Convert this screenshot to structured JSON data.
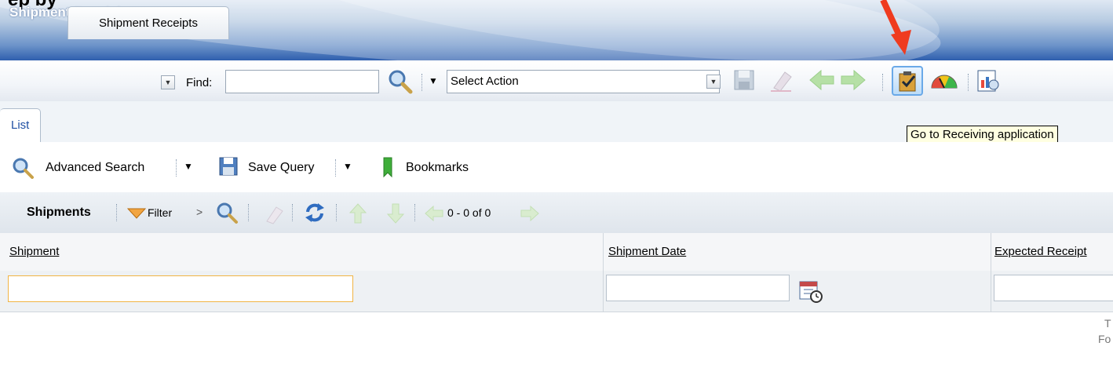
{
  "overlay": {
    "caption": "ep by"
  },
  "app": {
    "title": "Shipment Receiving"
  },
  "toolbar": {
    "find_label": "Find:",
    "find_value": "",
    "action_select": "Select Action"
  },
  "tooltip": {
    "text": "Go to Receiving application"
  },
  "tabs": [
    {
      "label": "List",
      "active": true
    },
    {
      "label": "Shipment Receipts",
      "active": false
    }
  ],
  "actions": {
    "advanced_search": "Advanced Search",
    "save_query": "Save Query",
    "bookmarks": "Bookmarks"
  },
  "grid": {
    "title": "Shipments",
    "filter": "Filter",
    "pager": "0 - 0 of 0",
    "columns": [
      "Shipment",
      "Shipment Date",
      "Expected Receipt"
    ],
    "footer_line1": "T",
    "footer_line2": "Fo"
  },
  "colors": {
    "arrow": "#ef3b1f",
    "highlight": "#f7b94a",
    "link_tab": "#1f4fa3"
  }
}
